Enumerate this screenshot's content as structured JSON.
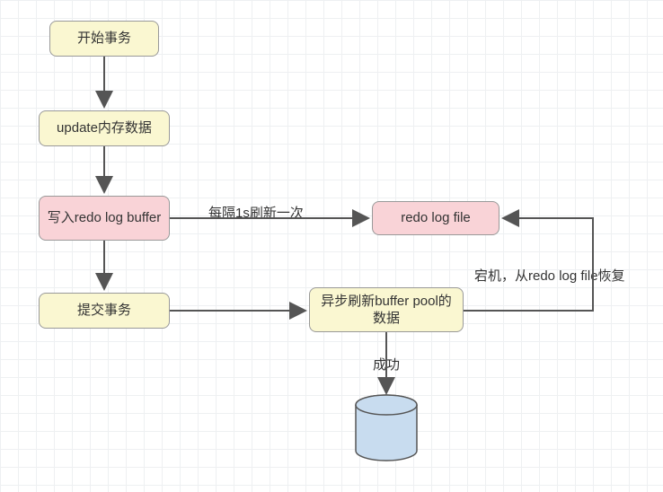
{
  "nodes": {
    "start": {
      "label": "开始事务"
    },
    "update": {
      "label": "update内存数据"
    },
    "redo_buffer": {
      "label": "写入redo log buffer"
    },
    "commit": {
      "label": "提交事务"
    },
    "redo_file": {
      "label": "redo log file"
    },
    "async_flush": {
      "label": "异步刷新buffer pool的数据"
    }
  },
  "edges": {
    "buffer_to_file": {
      "label": "每隔1s刷新一次"
    },
    "flush_success": {
      "label": "成功"
    },
    "flush_to_file": {
      "label": "宕机，从redo log file恢复"
    }
  }
}
